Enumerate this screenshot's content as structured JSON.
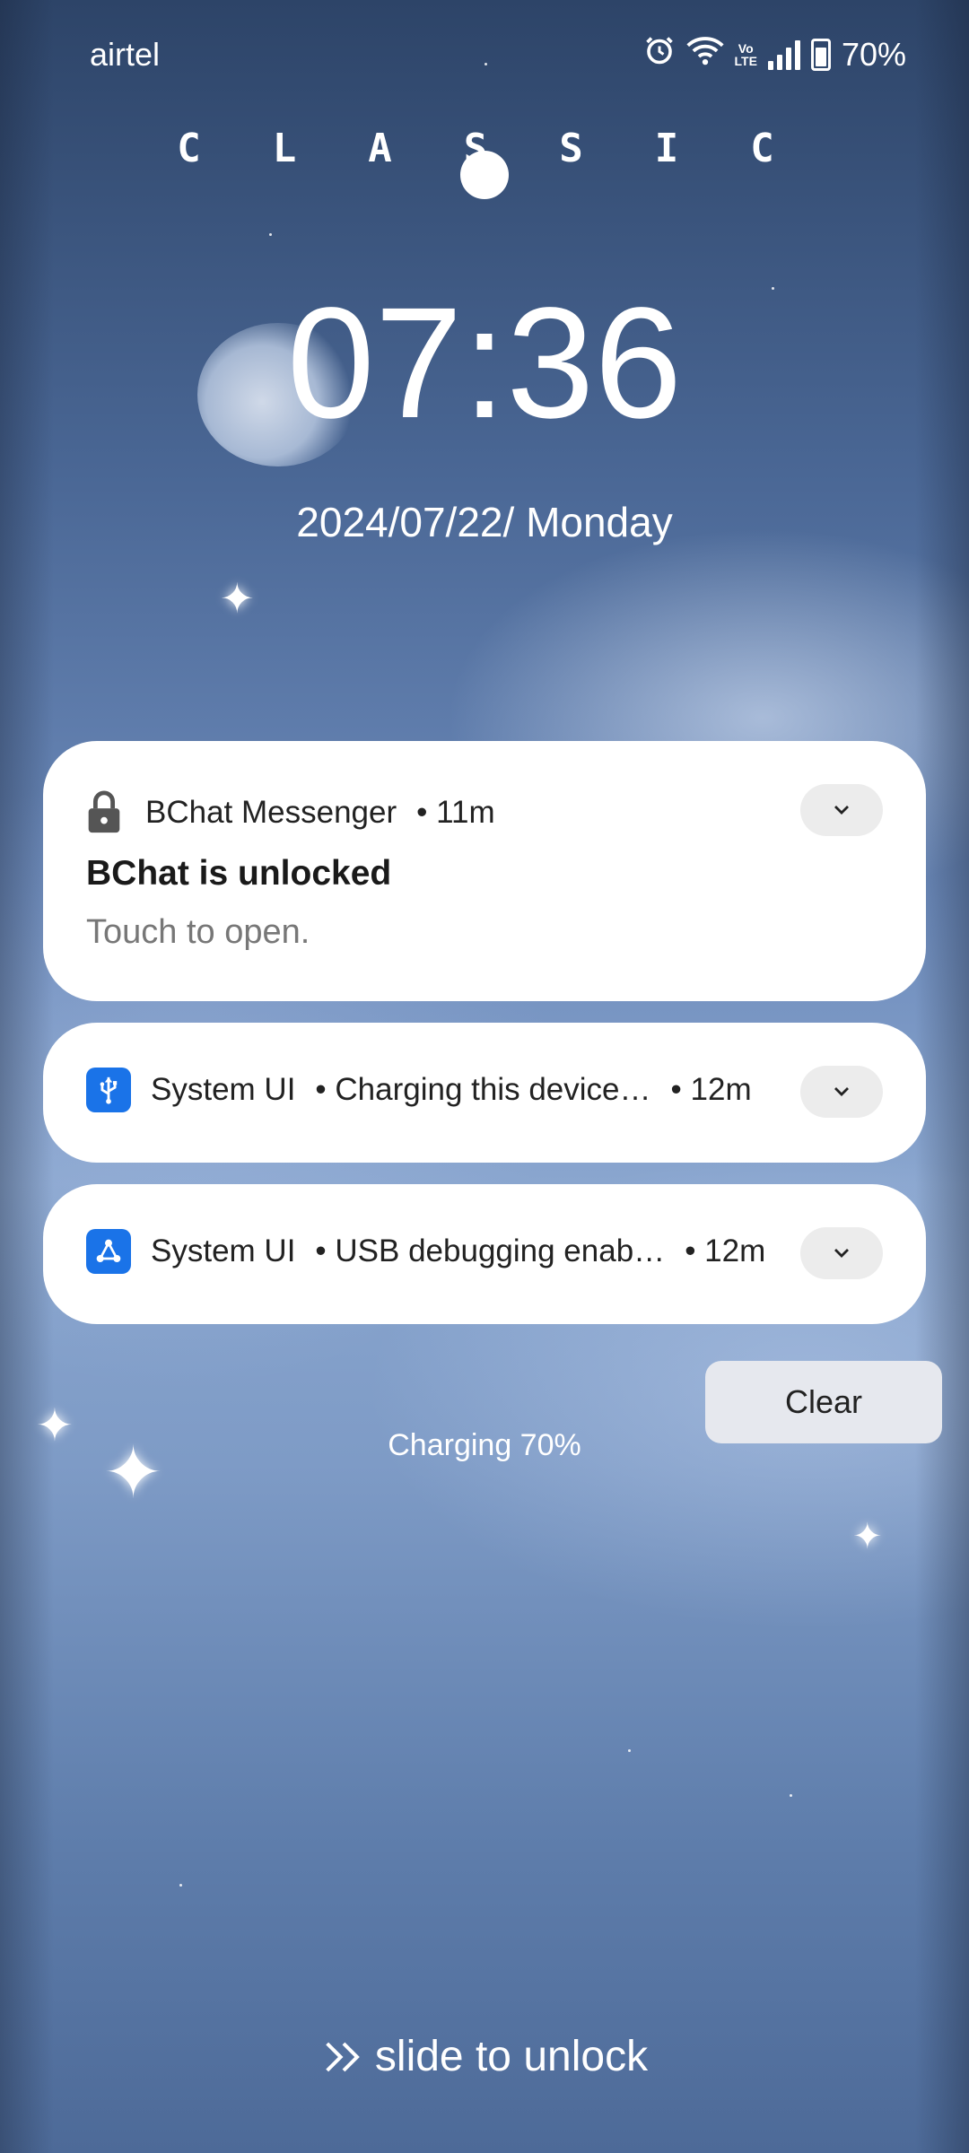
{
  "status_bar": {
    "carrier": "airtel",
    "battery_text": "70%",
    "icons": [
      "alarm-icon",
      "wifi-icon",
      "volte-icon",
      "signal-icon",
      "battery-charging-icon"
    ],
    "volte_top": "Vo",
    "volte_bottom": "LTE"
  },
  "theme_label": "CLASSIC",
  "clock": {
    "time": "07:36",
    "date": "2024/07/22/ Monday"
  },
  "notifications": [
    {
      "app": "BChat Messenger",
      "time": "• 11m",
      "title": "BChat is unlocked",
      "body": "Touch to open.",
      "icon": "lock-icon"
    },
    {
      "app": "System UI",
      "summary": "• Charging this device…",
      "time": "• 12m",
      "icon": "usb-icon"
    },
    {
      "app": "System UI",
      "summary": "• USB debugging enab…",
      "time": "• 12m",
      "icon": "usb-debug-icon"
    }
  ],
  "clear_label": "Clear",
  "charging_text": "Charging 70%",
  "unlock_text": "slide to unlock",
  "colors": {
    "card_bg": "#ffffff",
    "system_ui_icon": "#1a73e8",
    "text_primary": "#1a1a1a",
    "text_secondary": "#777777"
  }
}
